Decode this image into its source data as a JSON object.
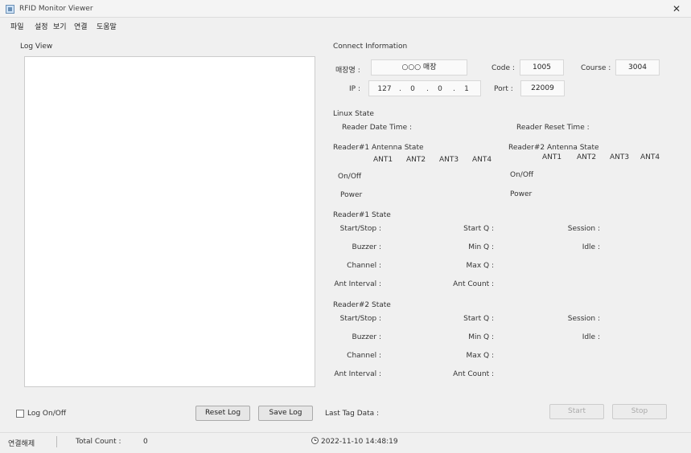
{
  "window": {
    "title": "RFID Monitor Viewer",
    "close_glyph": "✕"
  },
  "menu": [
    "파일",
    "설정",
    "보기",
    "연결",
    "도움말"
  ],
  "log_view": {
    "title": "Log View"
  },
  "connect_info": {
    "title": "Connect Information",
    "site_label": "매장명 :",
    "site_value": "○○○ 매장",
    "code_label": "Code :",
    "code_value": "1005",
    "course_label": "Course :",
    "course_value": "3004",
    "ip_label": "IP :",
    "ip": [
      "127",
      "0",
      "0",
      "1"
    ],
    "ip_dot": ".",
    "port_label": "Port :",
    "port_value": "22009"
  },
  "linux_state": {
    "title": "Linux State",
    "reader_date_time": "Reader Date Time :",
    "reader_reset_time": "Reader Reset Time :"
  },
  "antenna1": {
    "title": "Reader#1 Antenna State",
    "ants": [
      "ANT1",
      "ANT2",
      "ANT3",
      "ANT4"
    ],
    "onoff": "On/Off",
    "power": "Power"
  },
  "antenna2": {
    "title": "Reader#2 Antenna State",
    "ants": [
      "ANT1",
      "ANT2",
      "ANT3",
      "ANT4"
    ],
    "onoff": "On/Off",
    "power": "Power"
  },
  "reader1": {
    "title": "Reader#1 State",
    "start_stop": "Start/Stop :",
    "buzzer": "Buzzer :",
    "channel": "Channel :",
    "ant_interval": "Ant Interval :",
    "start_q": "Start Q :",
    "min_q": "Min Q :",
    "max_q": "Max Q :",
    "ant_count": "Ant Count :",
    "session": "Session :",
    "idle": "Idle :"
  },
  "reader2": {
    "title": "Reader#2 State",
    "start_stop": "Start/Stop :",
    "buzzer": "Buzzer :",
    "channel": "Channel :",
    "ant_interval": "Ant Interval :",
    "start_q": "Start Q :",
    "min_q": "Min Q :",
    "max_q": "Max Q :",
    "ant_count": "Ant Count :",
    "session": "Session :",
    "idle": "Idle :"
  },
  "bottom": {
    "log_onoff": "Log On/Off",
    "reset_log": "Reset Log",
    "save_log": "Save Log",
    "last_tag_data": "Last Tag Data :",
    "btn_start": "Start",
    "btn_stop": "Stop"
  },
  "status": {
    "connected": "연결해제",
    "total_count_label": "Total Count :",
    "total_count_value": "0",
    "datetime": "2022-11-10 14:48:19"
  }
}
